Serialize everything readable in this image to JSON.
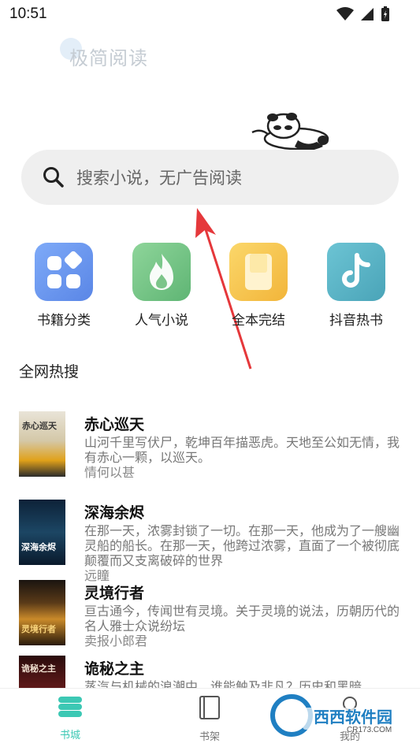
{
  "status_bar": {
    "time": "10:51"
  },
  "header": {
    "logo_text": "极简阅读"
  },
  "search": {
    "placeholder": "搜索小说，无广告阅读"
  },
  "quick_links": [
    {
      "label": "书籍分类",
      "icon": "grid-icon",
      "color": "#6c9af0"
    },
    {
      "label": "人气小说",
      "icon": "flame-icon",
      "color": "#7cc58a"
    },
    {
      "label": "全本完结",
      "icon": "book-icon",
      "color": "#f5c451"
    },
    {
      "label": "抖音热书",
      "icon": "tiktok-icon",
      "color": "#5cb5c6"
    }
  ],
  "section": {
    "title": "全网热搜"
  },
  "books": [
    {
      "title": "赤心巡天",
      "description": "山河千里写伏尸，乾坤百年描恶虎。天地至公如无情，我有赤心一颗，以巡天。",
      "author": "情何以甚",
      "cover_text": "赤心巡天"
    },
    {
      "title": "深海余烬",
      "description": "在那一天，浓雾封锁了一切。在那一天，他成为了一艘幽灵船的船长。在那一天，他跨过浓雾，直面了一个被彻底颠覆而又支离破碎的世界",
      "author": "远瞳",
      "cover_text": "深海余烬"
    },
    {
      "title": "灵境行者",
      "description": "亘古通今，传闻世有灵境。关于灵境的说法，历朝历代的名人雅士众说纷坛",
      "author": "卖报小郎君",
      "cover_text": "灵境行者"
    },
    {
      "title": "诡秘之主",
      "description": "蒸汽与机械的浪潮中，谁能触及非凡？历史和黑暗",
      "author": "",
      "cover_text": "诡秘之主"
    }
  ],
  "bottom_nav": [
    {
      "label": "书城",
      "icon": "store-icon",
      "active": true
    },
    {
      "label": "书架",
      "icon": "bookshelf-icon",
      "active": false
    },
    {
      "label": "我的",
      "icon": "profile-icon",
      "active": false
    }
  ],
  "watermark": {
    "text": "西西软件园",
    "subtext": "CR173.COM"
  },
  "colors": {
    "accent": "#3cc8b4",
    "text_primary": "#111111",
    "text_secondary": "#777777"
  }
}
